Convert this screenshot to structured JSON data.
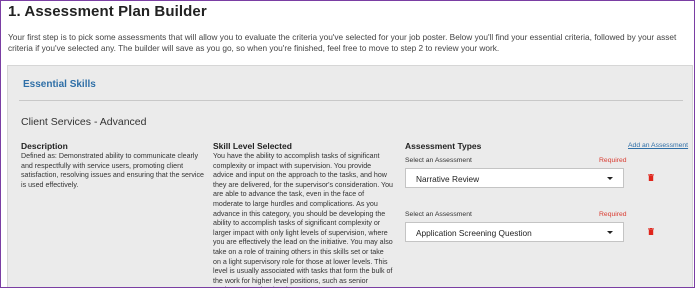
{
  "page": {
    "title": "1. Assessment Plan Builder",
    "intro": "Your first step is to pick some assessments that will allow you to evaluate the criteria you've selected for your job poster. Below you'll find your essential criteria, followed by your asset criteria if you've selected any. The builder will save as you go, so when you're finished, feel free to move to step 2 to review your work."
  },
  "section": {
    "title": "Essential Skills",
    "skill_name": "Client Services - Advanced"
  },
  "description": {
    "heading": "Description",
    "text": "Defined as: Demonstrated ability to communicate clearly and respectfully with service users, promoting client satisfaction, resolving issues and ensuring that the service is used effectively."
  },
  "skill_level": {
    "heading": "Skill Level Selected",
    "text": "You have the ability to accomplish tasks of significant complexity or impact with supervision. You provide advice and input on the approach to the tasks, and how they are delivered, for the supervisor's consideration. You are able to advance the task, even in the face of moderate to large hurdles and complications. As you advance in this category, you should be developing the ability to accomplish tasks of significant complexity or larger impact with only light levels of supervision, where you are effectively the lead on the initiative. You may also take on a role of training others in this skills set or take on a light supervisory role for those at lower levels. This level is usually associated with tasks that form the bulk of the work for higher level positions, such as senior analysts or senior developers."
  },
  "assessment_types": {
    "heading": "Assessment Types",
    "add_link": "Add an Assessment",
    "items": [
      {
        "label": "Select an Assessment",
        "required": "Required",
        "value": "Narrative Review",
        "delete_icon": "trash-icon"
      },
      {
        "label": "Select an Assessment",
        "required": "Required",
        "value": "Application Screening Question",
        "delete_icon": "trash-icon"
      }
    ]
  },
  "colors": {
    "accent": "#2f6fa7",
    "required": "#d93b30",
    "delete": "#e0251b",
    "frame": "#7a3ea3",
    "panel": "#ebebeb"
  }
}
